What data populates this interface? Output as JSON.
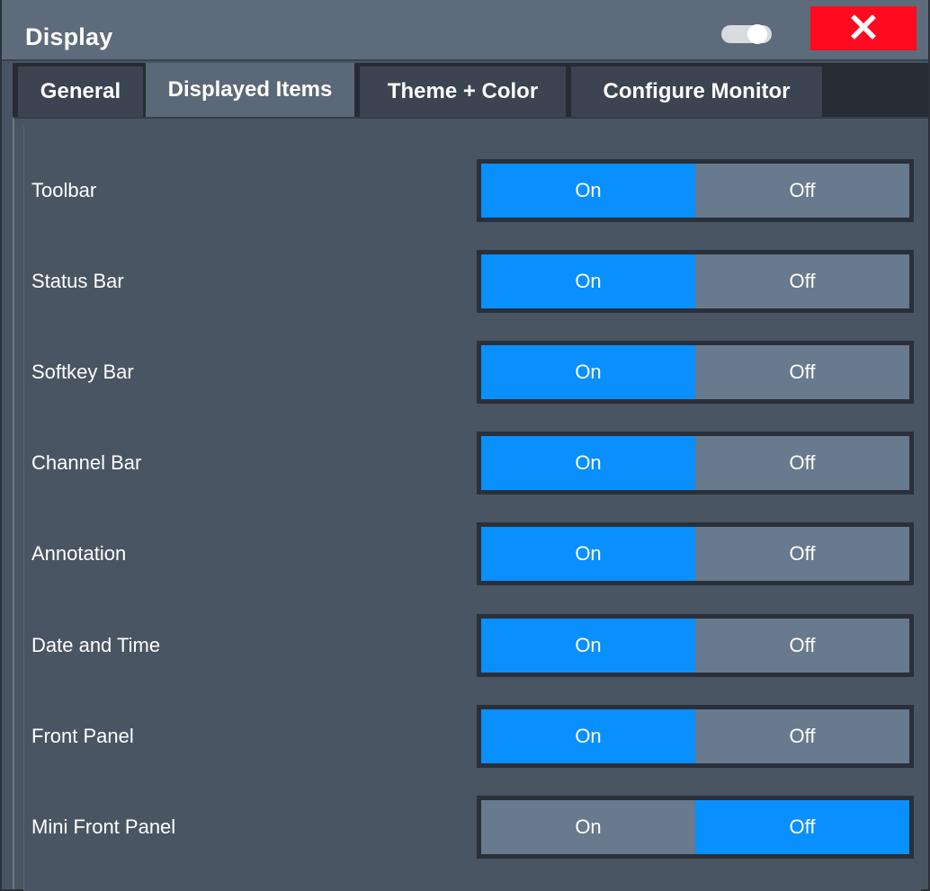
{
  "dialog": {
    "title": "Display",
    "toggle_icon": "toggle-switch-icon",
    "close_icon": "close-icon",
    "close_color": "#ff0a1f"
  },
  "tabs": [
    {
      "label": "General",
      "active": false
    },
    {
      "label": "Displayed Items",
      "active": true
    },
    {
      "label": "Theme + Color",
      "active": false
    },
    {
      "label": "Configure Monitor",
      "active": false
    }
  ],
  "accent_color": "#0a8fff",
  "items": [
    {
      "label": "Toolbar",
      "on": "On",
      "off": "Off",
      "selected": "On"
    },
    {
      "label": "Status Bar",
      "on": "On",
      "off": "Off",
      "selected": "On"
    },
    {
      "label": "Softkey Bar",
      "on": "On",
      "off": "Off",
      "selected": "On"
    },
    {
      "label": "Channel Bar",
      "on": "On",
      "off": "Off",
      "selected": "On"
    },
    {
      "label": "Annotation",
      "on": "On",
      "off": "Off",
      "selected": "On"
    },
    {
      "label": "Date and Time",
      "on": "On",
      "off": "Off",
      "selected": "On"
    },
    {
      "label": "Front Panel",
      "on": "On",
      "off": "Off",
      "selected": "On"
    },
    {
      "label": "Mini Front Panel",
      "on": "On",
      "off": "Off",
      "selected": "Off"
    }
  ]
}
